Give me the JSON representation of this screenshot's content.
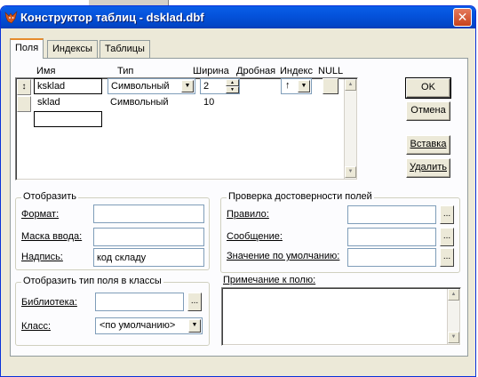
{
  "window": {
    "title": "Конструктор таблиц - dsklad.dbf",
    "close_glyph": "✕"
  },
  "tabs": [
    {
      "label": "Поля",
      "active": true
    },
    {
      "label": "Индексы",
      "active": false
    },
    {
      "label": "Таблицы",
      "active": false
    }
  ],
  "grid": {
    "headers": {
      "name": "Имя",
      "type": "Тип",
      "width": "Ширина",
      "decimal": "Дробная",
      "index": "Индекс",
      "null": "NULL"
    },
    "rows": [
      {
        "marker": "↕",
        "name": "ksklad",
        "type": "Символьный",
        "width": "2",
        "index_glyph": "↑"
      },
      {
        "marker": "",
        "name": "sklad",
        "type": "Символьный",
        "width": "10"
      }
    ],
    "new_row_value": ""
  },
  "buttons": {
    "ok": "OK",
    "cancel": "Отмена",
    "insert": "Вставка",
    "delete": "Удалить"
  },
  "display_group": {
    "title": "Отобразить",
    "format_label": "Формат:",
    "format_value": "",
    "mask_label": "Маска ввода:",
    "mask_value": "",
    "caption_label": "Надпись:",
    "caption_value": "код складу"
  },
  "validation_group": {
    "title": "Проверка достоверности полей",
    "rule_label": "Правило:",
    "rule_value": "",
    "message_label": "Сообщение:",
    "message_value": "",
    "default_label": "Значение по умолчанию:",
    "default_value": ""
  },
  "class_group": {
    "title": "Отобразить тип поля в классы",
    "library_label": "Библиотека:",
    "library_value": "",
    "class_label": "Класс:",
    "class_value": "<по умолчанию>"
  },
  "comment": {
    "label": "Примечание к полю:",
    "value": ""
  },
  "ellipsis": "...",
  "colors": {
    "title_bar": "#0453dc",
    "face": "#ece9d8",
    "close": "#c8431c",
    "tab_accent": "#e68b2c"
  }
}
